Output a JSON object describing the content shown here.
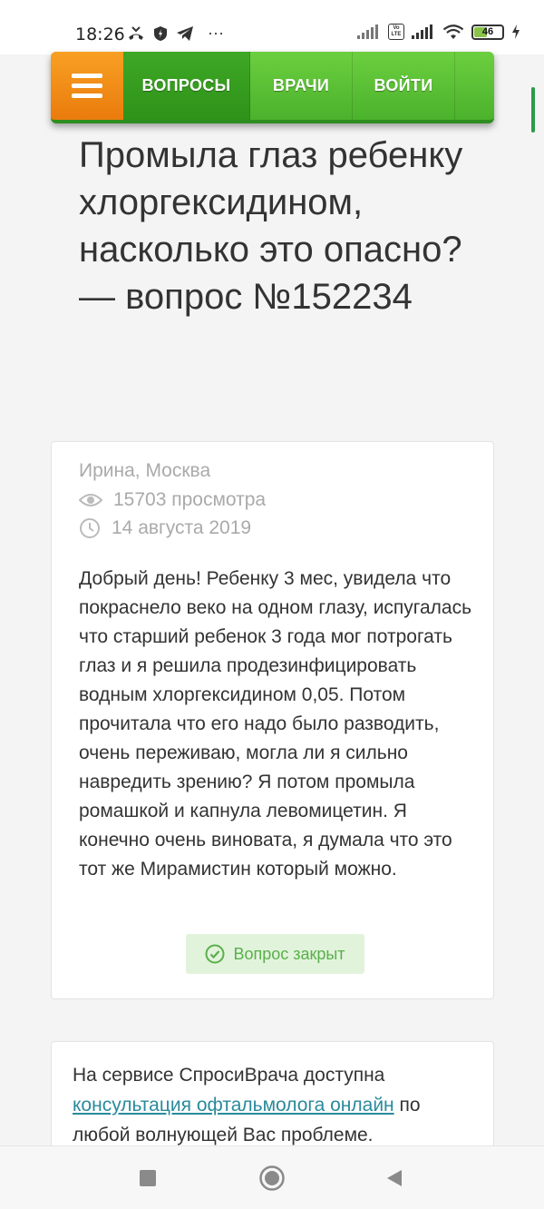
{
  "status_bar": {
    "time": "18:26",
    "more": "···",
    "volte": "Vo LTE",
    "battery": "46"
  },
  "navbar": {
    "items": [
      {
        "label": "ВОПРОСЫ",
        "active": true
      },
      {
        "label": "ВРАЧИ",
        "active": false
      },
      {
        "label": "ВОЙТИ",
        "active": false
      }
    ]
  },
  "question": {
    "title": "Промыла глаз ребенку хлоргексидином, насколько это опасно? — вопрос №152234",
    "author": "Ирина, Москва",
    "views": "15703 просмотра",
    "date": "14 августа 2019",
    "text": "Добрый день! Ребенку 3 мес, увидела что покраснело веко на одном глазу, испугалась что старший ребенок 3 года мог потрогать глаз и я решила продезинфицировать водным хлоргексидином 0,05. Потом прочитала что его надо было разводить, очень переживаю, могла ли я сильно навредить зрению? Я потом промыла ромашкой и капнула левомицетин. Я конечно очень виновата, я думала что это тот же Мирамистин который можно.",
    "status": "Вопрос закрыт"
  },
  "service": {
    "prefix": "На сервисе СпросиВрача доступна",
    "link": "консультация офтальмолога онлайн",
    "suffix": " по любой волнующей Вас проблеме."
  },
  "colors": {
    "nav_green": "#4bb22c",
    "nav_active": "#2f9219",
    "burger_orange": "#f8a024",
    "closed_badge_bg": "#e2f3dc",
    "closed_badge_text": "#58b04a",
    "link": "#2a8a9c"
  }
}
